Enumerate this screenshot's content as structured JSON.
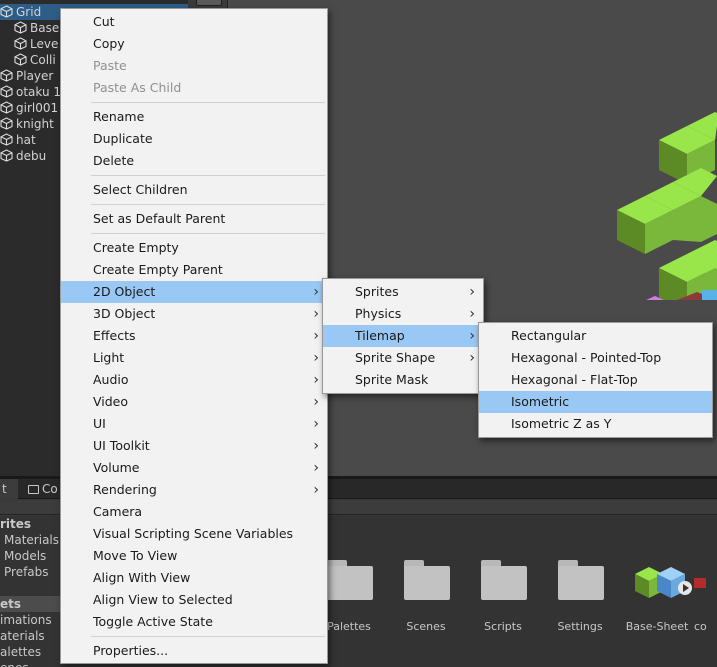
{
  "hierarchy": {
    "items": [
      {
        "label": "Grid",
        "selected": true
      },
      {
        "label": "Base"
      },
      {
        "label": "Leve"
      },
      {
        "label": "Colli"
      },
      {
        "label": "Player"
      },
      {
        "label": "otaku 1"
      },
      {
        "label": "girl001"
      },
      {
        "label": "knight"
      },
      {
        "label": "hat"
      },
      {
        "label": "debu"
      }
    ]
  },
  "bottom_panel": {
    "tabs": [
      "t",
      "Co"
    ],
    "project_tree": [
      "rites",
      "Materials",
      "Models",
      "Prefabs",
      "ets",
      "imations",
      "aterials",
      "alettes",
      "enes"
    ],
    "assets": [
      "Palettes",
      "Scenes",
      "Scripts",
      "Settings",
      "Base-Sheet",
      "co"
    ]
  },
  "context_menu": {
    "items": [
      {
        "label": "Cut"
      },
      {
        "label": "Copy"
      },
      {
        "label": "Paste",
        "disabled": true
      },
      {
        "label": "Paste As Child",
        "disabled": true
      },
      {
        "label": "Rename"
      },
      {
        "label": "Duplicate"
      },
      {
        "label": "Delete"
      },
      {
        "label": "Select Children"
      },
      {
        "label": "Set as Default Parent"
      },
      {
        "label": "Create Empty"
      },
      {
        "label": "Create Empty Parent"
      },
      {
        "label": "2D Object",
        "submenu": true,
        "active": true
      },
      {
        "label": "3D Object",
        "submenu": true
      },
      {
        "label": "Effects",
        "submenu": true
      },
      {
        "label": "Light",
        "submenu": true
      },
      {
        "label": "Audio",
        "submenu": true
      },
      {
        "label": "Video",
        "submenu": true
      },
      {
        "label": "UI",
        "submenu": true
      },
      {
        "label": "UI Toolkit",
        "submenu": true
      },
      {
        "label": "Volume",
        "submenu": true
      },
      {
        "label": "Rendering",
        "submenu": true
      },
      {
        "label": "Camera"
      },
      {
        "label": "Visual Scripting Scene Variables"
      },
      {
        "label": "Move To View"
      },
      {
        "label": "Align With View"
      },
      {
        "label": "Align View to Selected"
      },
      {
        "label": "Toggle Active State"
      },
      {
        "label": "Properties..."
      }
    ]
  },
  "submenu_2d": {
    "items": [
      {
        "label": "Sprites",
        "submenu": true
      },
      {
        "label": "Physics",
        "submenu": true
      },
      {
        "label": "Tilemap",
        "submenu": true,
        "active": true
      },
      {
        "label": "Sprite Shape",
        "submenu": true
      },
      {
        "label": "Sprite Mask"
      }
    ]
  },
  "submenu_tilemap": {
    "items": [
      {
        "label": "Rectangular"
      },
      {
        "label": "Hexagonal - Pointed-Top"
      },
      {
        "label": "Hexagonal - Flat-Top"
      },
      {
        "label": "Isometric",
        "active": true
      },
      {
        "label": "Isometric Z as Y"
      }
    ]
  },
  "icons": {
    "submenu_arrow": "›"
  },
  "colors": {
    "menu_highlight": "#99c8f5",
    "selection": "#2c5d87",
    "tile_top": "#99e64b",
    "tile_side": "#5c8a24"
  }
}
